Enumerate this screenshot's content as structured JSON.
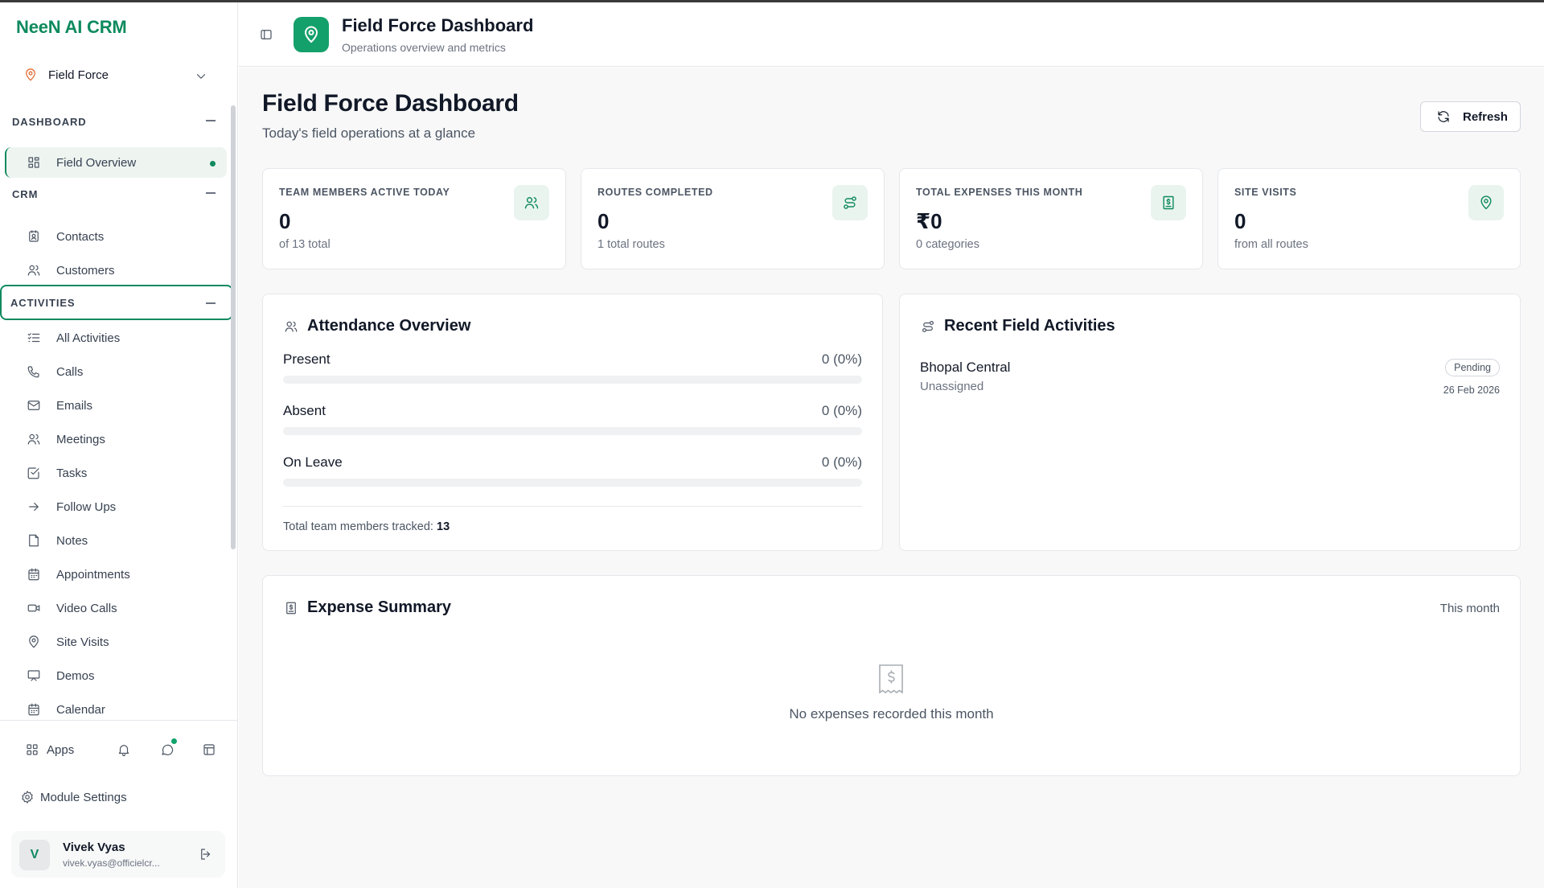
{
  "brand": "NeeN AI CRM",
  "module_selector": {
    "label": "Field Force"
  },
  "sidebar": {
    "sections": [
      {
        "label": "DASHBOARD"
      },
      {
        "label": "CRM"
      },
      {
        "label": "ACTIVITIES"
      }
    ],
    "dashboard_items": [
      {
        "label": "Field Overview",
        "icon": "grid-icon"
      }
    ],
    "crm_items": [
      {
        "label": "Contacts",
        "icon": "contact-card-icon"
      },
      {
        "label": "Customers",
        "icon": "users-icon"
      }
    ],
    "activity_items": [
      {
        "label": "All Activities",
        "icon": "list-check-icon"
      },
      {
        "label": "Calls",
        "icon": "phone-icon"
      },
      {
        "label": "Emails",
        "icon": "mail-icon"
      },
      {
        "label": "Meetings",
        "icon": "users-icon"
      },
      {
        "label": "Tasks",
        "icon": "checkbox-icon"
      },
      {
        "label": "Follow Ups",
        "icon": "arrow-right-icon"
      },
      {
        "label": "Notes",
        "icon": "note-icon"
      },
      {
        "label": "Appointments",
        "icon": "calendar-icon"
      },
      {
        "label": "Video Calls",
        "icon": "video-icon"
      },
      {
        "label": "Site Visits",
        "icon": "map-pin-icon"
      },
      {
        "label": "Demos",
        "icon": "presentation-icon"
      },
      {
        "label": "Calendar",
        "icon": "calendar-icon"
      }
    ],
    "apps_label": "Apps",
    "module_settings_label": "Module Settings",
    "user": {
      "initial": "V",
      "name": "Vivek Vyas",
      "email": "vivek.vyas@officielcr..."
    }
  },
  "header": {
    "title": "Field Force Dashboard",
    "subtitle": "Operations overview and metrics"
  },
  "page": {
    "title": "Field Force Dashboard",
    "subtitle": "Today's field operations at a glance",
    "refresh_label": "Refresh"
  },
  "stats": [
    {
      "label": "TEAM MEMBERS ACTIVE TODAY",
      "value": "0",
      "note": "of 13 total",
      "icon": "users-icon"
    },
    {
      "label": "ROUTES COMPLETED",
      "value": "0",
      "note": "1 total routes",
      "icon": "route-icon"
    },
    {
      "label": "TOTAL EXPENSES THIS MONTH",
      "value": "₹0",
      "note": "0 categories",
      "icon": "receipt-icon"
    },
    {
      "label": "SITE VISITS",
      "value": "0",
      "note": "from all routes",
      "icon": "map-pin-icon"
    }
  ],
  "attendance": {
    "title": "Attendance Overview",
    "rows": [
      {
        "label": "Present",
        "value": "0 (0%)",
        "fraction": 0
      },
      {
        "label": "Absent",
        "value": "0 (0%)",
        "fraction": 0
      },
      {
        "label": "On Leave",
        "value": "0 (0%)",
        "fraction": 0
      }
    ],
    "total_label": "Total team members tracked:",
    "total_value": "13"
  },
  "recent": {
    "title": "Recent Field Activities",
    "items": [
      {
        "name": "Bhopal Central",
        "assignee": "Unassigned",
        "status": "Pending",
        "date": "26 Feb 2026"
      }
    ]
  },
  "expenses": {
    "title": "Expense Summary",
    "period": "This month",
    "empty_text": "No expenses recorded this month"
  },
  "colors": {
    "accent": "#0f8a5f",
    "accent_bg": "#eaf4ef",
    "logo_bg": "#14a06b"
  }
}
